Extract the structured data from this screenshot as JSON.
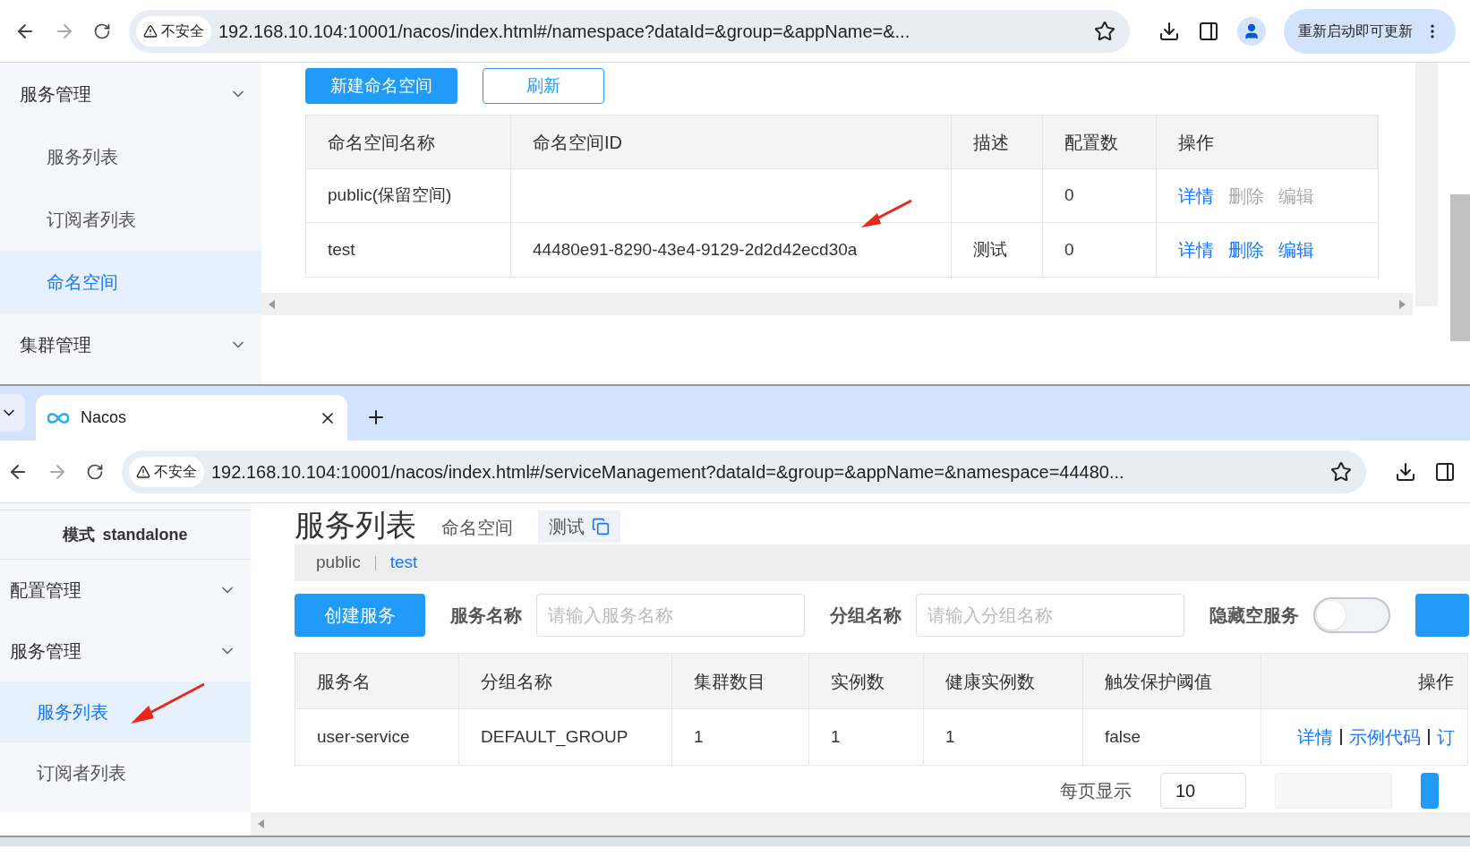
{
  "top_window": {
    "address_bar": {
      "security_label": "不安全",
      "url": "192.168.10.104:10001/nacos/index.html#/namespace?dataId=&group=&appName=&..."
    },
    "update_button": "重新启动即可更新",
    "toolbar_buttons": [
      {
        "label": "新建命名空间",
        "kind": "primary"
      },
      {
        "label": "刷新",
        "kind": "secondary"
      }
    ],
    "sidebar": [
      {
        "label": "服务管理",
        "kind": "group",
        "selected": false
      },
      {
        "label": "服务列表",
        "kind": "item",
        "selected": false
      },
      {
        "label": "订阅者列表",
        "kind": "item",
        "selected": false
      },
      {
        "label": "命名空间",
        "kind": "item",
        "selected": true
      },
      {
        "label": "集群管理",
        "kind": "group",
        "selected": false
      }
    ],
    "table": {
      "columns": [
        "命名空间名称",
        "命名空间ID",
        "描述",
        "配置数",
        "操作"
      ],
      "rows": [
        {
          "cells": [
            "public(保留空间)",
            "",
            "",
            "0"
          ],
          "actions": [
            {
              "label": "详情",
              "disabled": false
            },
            {
              "label": "删除",
              "disabled": true
            },
            {
              "label": "编辑",
              "disabled": true
            }
          ]
        },
        {
          "cells": [
            "test",
            "44480e91-8290-43e4-9129-2d2d42ecd30a",
            "测试",
            "0"
          ],
          "actions": [
            {
              "label": "详情",
              "disabled": false
            },
            {
              "label": "删除",
              "disabled": false
            },
            {
              "label": "编辑",
              "disabled": false
            }
          ]
        }
      ]
    }
  },
  "bottom_window": {
    "tab": {
      "title": "Nacos"
    },
    "address_bar": {
      "security_label": "不安全",
      "url": "192.168.10.104:10001/nacos/index.html#/serviceManagement?dataId=&group=&appName=&namespace=44480..."
    },
    "sidebar": {
      "mode": {
        "label": "模式",
        "value": "standalone"
      },
      "items": [
        {
          "label": "配置管理",
          "kind": "group",
          "selected": false
        },
        {
          "label": "服务管理",
          "kind": "group",
          "selected": false
        },
        {
          "label": "服务列表",
          "kind": "item",
          "selected": true
        },
        {
          "label": "订阅者列表",
          "kind": "item",
          "selected": false
        }
      ]
    },
    "page_title": "服务列表",
    "namespace_label": "命名空间",
    "namespace_value": "测试",
    "namespaces": [
      {
        "label": "public",
        "selected": false
      },
      {
        "label": "test",
        "selected": true
      }
    ],
    "create_button": "创建服务",
    "filters": [
      {
        "label": "服务名称",
        "placeholder": "请输入服务名称"
      },
      {
        "label": "分组名称",
        "placeholder": "请输入分组名称"
      }
    ],
    "hide_empty": {
      "label": "隐藏空服务",
      "on": false
    },
    "table": {
      "columns": [
        "服务名",
        "分组名称",
        "集群数目",
        "实例数",
        "健康实例数",
        "触发保护阈值",
        "操作"
      ],
      "rows": [
        {
          "cells": [
            "user-service",
            "DEFAULT_GROUP",
            "1",
            "1",
            "1",
            "false"
          ],
          "actions": [
            {
              "label": "详情"
            },
            {
              "label": "示例代码"
            },
            {
              "label": "订"
            }
          ]
        }
      ]
    },
    "pagination": {
      "label": "每页显示",
      "page_size": "10"
    }
  }
}
